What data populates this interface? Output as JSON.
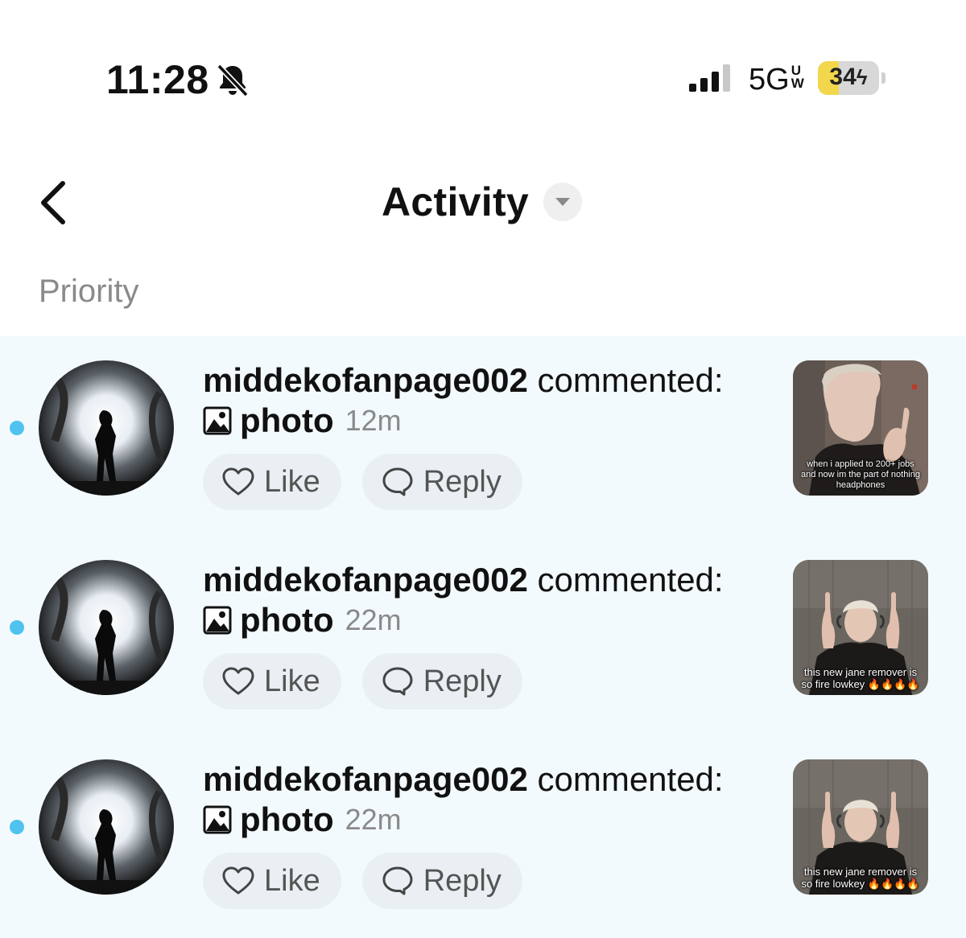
{
  "status_bar": {
    "time": "11:28",
    "network": "5G",
    "network_sub_top": "U",
    "network_sub_bottom": "W",
    "battery": "34",
    "battery_level_percent": 34,
    "icons": [
      "bell-slash-icon",
      "signal-icon",
      "battery-charging-icon"
    ]
  },
  "header": {
    "title": "Activity",
    "back_icon": "chevron-left-icon",
    "dropdown_icon": "caret-down-icon"
  },
  "section": {
    "label": "Priority"
  },
  "colors": {
    "unread_dot": "#4fc3ee",
    "list_background": "#f3fafd",
    "pill_background": "#e9eff2",
    "muted_text": "#8a8a8a"
  },
  "notifications": [
    {
      "username": "middekofanpage002",
      "action": "commented:",
      "content": "photo",
      "time": "12m",
      "like_label": "Like",
      "reply_label": "Reply",
      "thumb_caption": "when i applied to 200+ jobs and now im the part of nothing headphones"
    },
    {
      "username": "middekofanpage002",
      "action": "commented:",
      "content": "photo",
      "time": "22m",
      "like_label": "Like",
      "reply_label": "Reply",
      "thumb_caption": "this new jane remover is so fire lowkey 🔥🔥🔥🔥"
    },
    {
      "username": "middekofanpage002",
      "action": "commented:",
      "content": "photo",
      "time": "22m",
      "like_label": "Like",
      "reply_label": "Reply",
      "thumb_caption": "this new jane remover is so fire lowkey 🔥🔥🔥🔥"
    }
  ]
}
